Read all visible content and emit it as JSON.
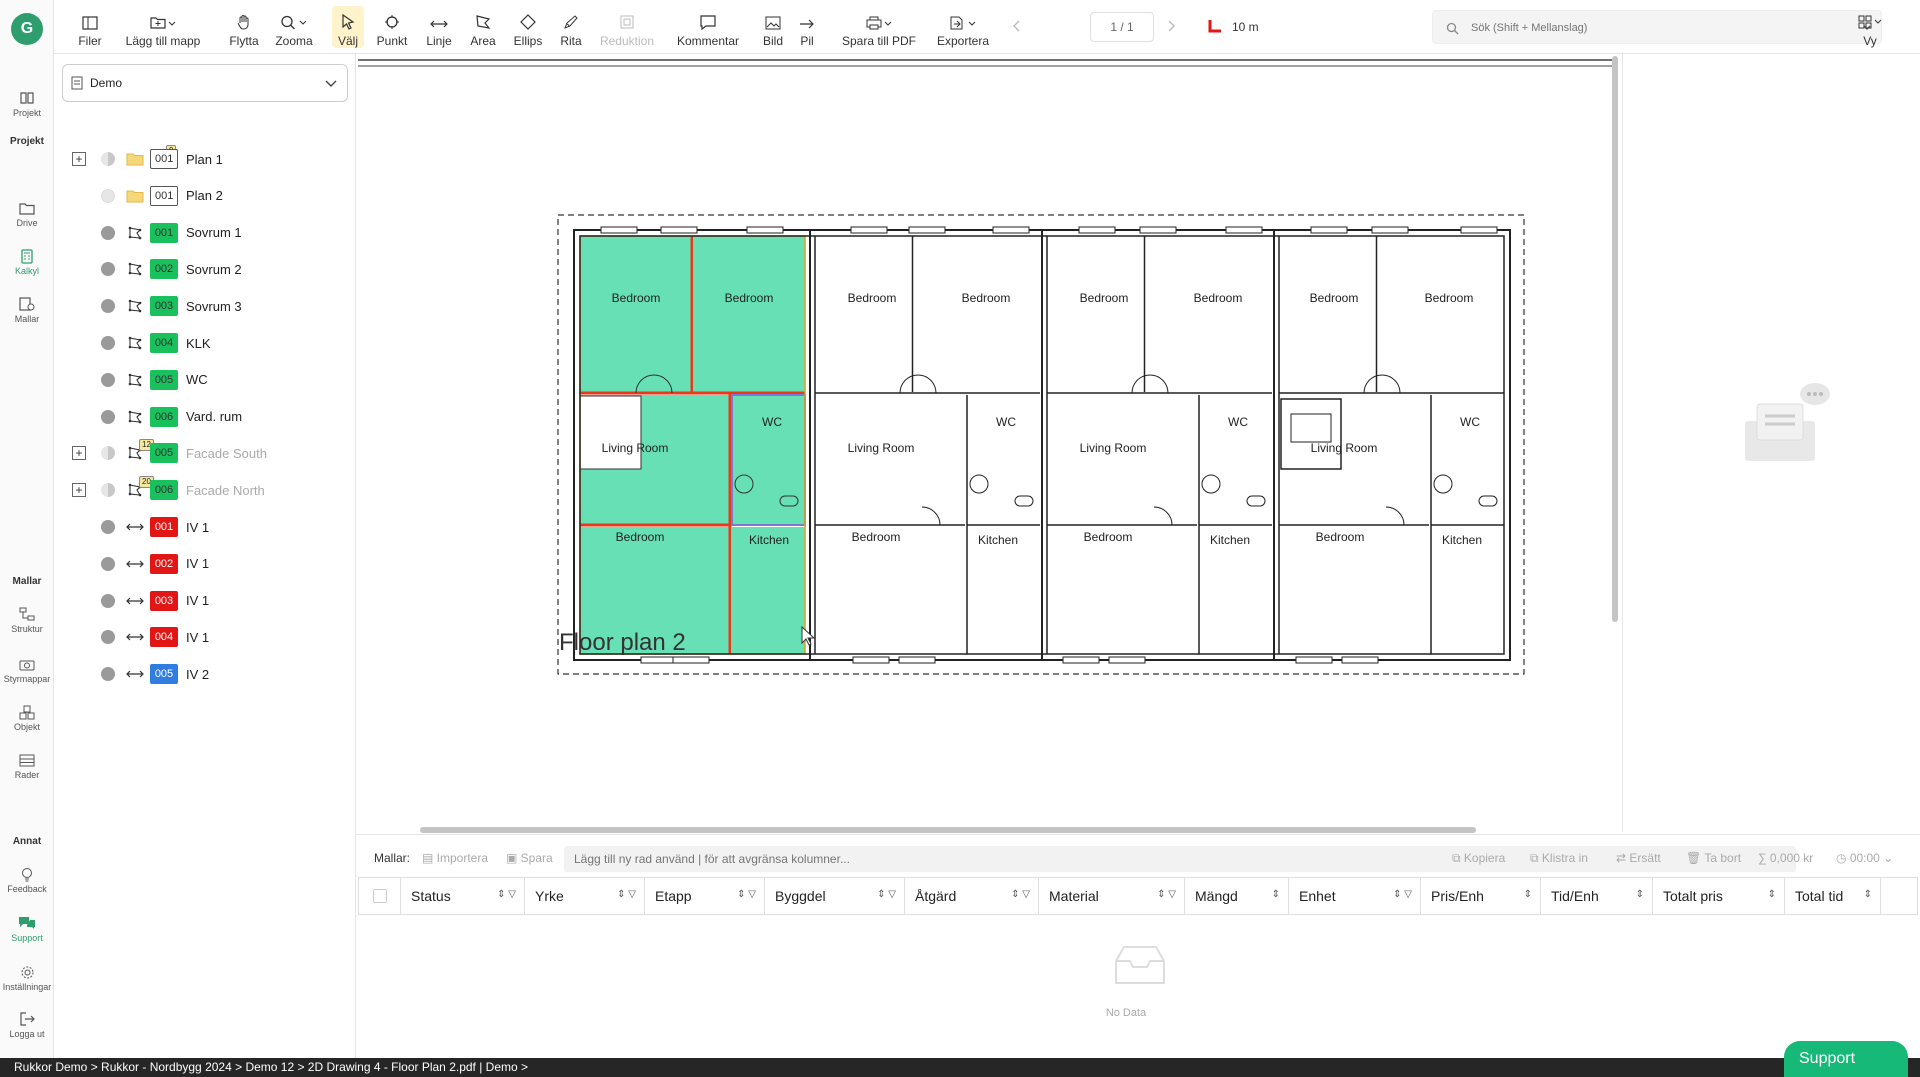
{
  "app": {
    "logo_letter": "G",
    "accent": "#2f9e6e",
    "support_color": "#16b978"
  },
  "rail": {
    "section_projekt": "Projekt",
    "section_mallar": "Mallar",
    "section_annat": "Annat",
    "items": {
      "projekt": "Projekt",
      "drive": "Drive",
      "kalkyl": "Kalkyl",
      "mallar": "Mallar",
      "struktur": "Struktur",
      "styrmappar": "Styrmappar",
      "objekt": "Objekt",
      "rader": "Rader",
      "feedback": "Feedback",
      "support": "Support",
      "installningar": "Inställningar",
      "logga_ut": "Logga ut"
    }
  },
  "toolbar": {
    "filer": "Filer",
    "lagg_till_mapp": "Lägg till mapp",
    "flytta": "Flytta",
    "zooma": "Zooma",
    "valj": "Välj",
    "punkt": "Punkt",
    "linje": "Linje",
    "area": "Area",
    "ellips": "Ellips",
    "rita": "Rita",
    "reduktion": "Reduktion",
    "kommentar": "Kommentar",
    "bild": "Bild",
    "pil": "Pil",
    "spara_pdf": "Spara till PDF",
    "exportera": "Exportera",
    "page": "1 / 1",
    "scale": "10 m",
    "search_placeholder": "Sök (Shift + Mellanslag)",
    "vy": "Vy"
  },
  "tree": {
    "project": "Demo",
    "rows": [
      {
        "code": "001",
        "label": "Plan 1",
        "count": "9"
      },
      {
        "code": "001",
        "label": "Plan 2"
      },
      {
        "code": "001",
        "label": "Sovrum 1"
      },
      {
        "code": "002",
        "label": "Sovrum 2"
      },
      {
        "code": "003",
        "label": "Sovrum 3"
      },
      {
        "code": "004",
        "label": "KLK"
      },
      {
        "code": "005",
        "label": "WC"
      },
      {
        "code": "006",
        "label": "Vard. rum"
      },
      {
        "code": "005",
        "label": "Facade South",
        "count": "12"
      },
      {
        "code": "006",
        "label": "Facade North",
        "count": "20"
      },
      {
        "code": "001",
        "label": "IV 1"
      },
      {
        "code": "002",
        "label": "IV 1"
      },
      {
        "code": "003",
        "label": "IV 1"
      },
      {
        "code": "004",
        "label": "IV 1"
      },
      {
        "code": "005",
        "label": "IV 2"
      }
    ]
  },
  "drawing": {
    "caption": "Floor plan 2",
    "room_labels": {
      "bedroom": "Bedroom",
      "living": "Living Room",
      "wc": "WC",
      "kitchen": "Kitchen"
    },
    "highlight_fill": "#66e0b4",
    "highlight_stroke": "#e53b1a"
  },
  "bottom": {
    "mallar": "Mallar:",
    "importera": "Importera",
    "spara": "Spara",
    "add_row_placeholder": "Lägg till ny rad använd | för att avgränsa kolumner...",
    "kopiera": "Kopiera",
    "klistra_in": "Klistra in",
    "ersatt": "Ersätt",
    "ta_bort": "Ta bort",
    "sum": "0,000 kr",
    "time": "00:00",
    "columns": [
      "Status",
      "Yrke",
      "Etapp",
      "Byggdel",
      "Åtgärd",
      "Material",
      "Mängd",
      "Enhet",
      "Pris/Enh",
      "Tid/Enh",
      "Totalt pris",
      "Total tid"
    ],
    "no_data": "No Data"
  },
  "statusbar": {
    "path": "Rukkor Demo > Rukkor - Nordbygg 2024 > Demo 12 > 2D Drawing 4 - Floor Plan 2.pdf  |  Demo >"
  },
  "support_button": "Support"
}
